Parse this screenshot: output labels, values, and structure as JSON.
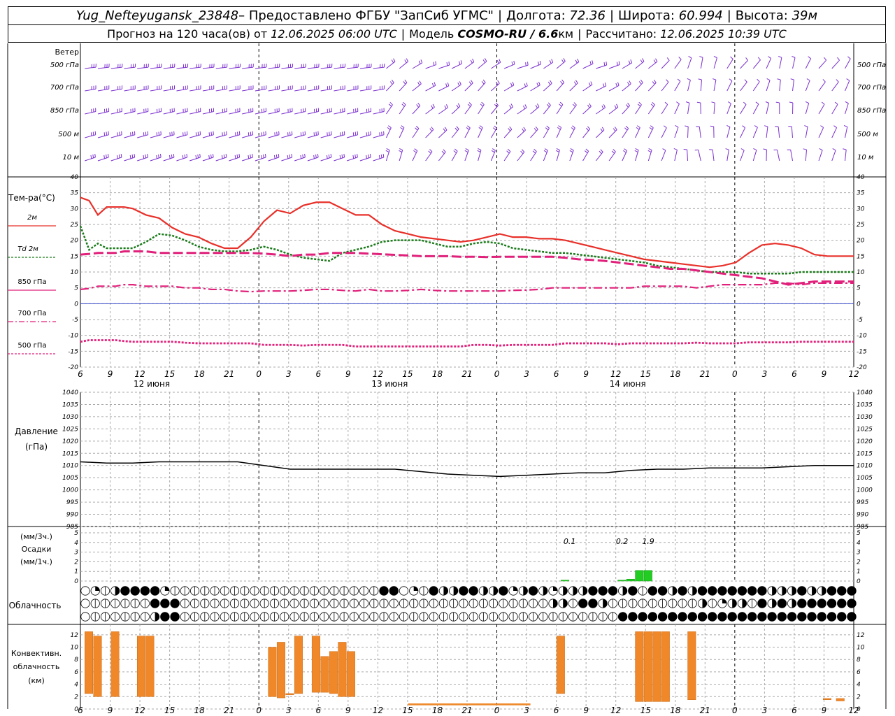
{
  "header": {
    "station": "Yug_Nefteyugansk_23848",
    "provider": " – Предоставлено ФГБУ \"ЗапСиб УГМС\"",
    "lon_label": "Долгота:",
    "lon": "72.36",
    "lat_label": "Широта:",
    "lat": "60.994",
    "alt_label": "Высота:",
    "alt": "39м",
    "forecast_label": "Прогноз на 120 часа(ов) от",
    "forecast_from": "12.06.2025 06:00 UTC",
    "model_label": "Модель",
    "model": "COSMO-RU / 6.6",
    "model_unit": "км",
    "calc_label": "Рассчитано:",
    "calc_time": "12.06.2025 10:39 UTC"
  },
  "time_axis": {
    "hour_labels": [
      "6",
      "9",
      "12",
      "15",
      "18",
      "21",
      "0",
      "3",
      "6",
      "9",
      "12",
      "15",
      "18",
      "21",
      "0",
      "3",
      "6",
      "9",
      "12",
      "15",
      "18",
      "21",
      "0",
      "3",
      "6",
      "9",
      "12"
    ],
    "day_labels": [
      "12 июня",
      "13 июня",
      "14 июня"
    ]
  },
  "wind": {
    "title": "Ветер",
    "levels": [
      "500 гПа",
      "700 гПа",
      "850 гПа",
      "500 м",
      "10 м"
    ],
    "color": "#7b2fd0"
  },
  "chart_data": [
    {
      "type": "line",
      "panel": "temperature",
      "ylabel": "Тем-ра(°C)",
      "ylim": [
        -20,
        40
      ],
      "yticks": [
        40,
        35,
        30,
        25,
        20,
        15,
        10,
        5,
        0,
        -5,
        -10,
        -15,
        -20
      ],
      "x_unit": "hours since 12.06.2025 06:00 UTC",
      "x": [
        0,
        2,
        4,
        6,
        8,
        10,
        12,
        15,
        18,
        21,
        24,
        27,
        30,
        33,
        36,
        39,
        42,
        45,
        48,
        51,
        54,
        57,
        60,
        63,
        66,
        69,
        72,
        75,
        78,
        81,
        84,
        87,
        90,
        93,
        96,
        99,
        102,
        105,
        108,
        111,
        114,
        117,
        120,
        123,
        126,
        129,
        132,
        135,
        138,
        141,
        144,
        147,
        150,
        153,
        156,
        159,
        162,
        165,
        168,
        171,
        174,
        177
      ],
      "legend": [
        "2м",
        "Td 2м",
        "850 гПа",
        "700 гПа",
        "500 гПа"
      ],
      "series": [
        {
          "name": "2м",
          "color": "#e8302a",
          "values": [
            33.5,
            32.5,
            28,
            30.5,
            30.5,
            30.5,
            30,
            28,
            27,
            24,
            22,
            21,
            19,
            17.5,
            17.5,
            21,
            26,
            29.5,
            28.5,
            31,
            32,
            32,
            30,
            28,
            28,
            25,
            23,
            22,
            21,
            20.5,
            20,
            19.5,
            20,
            21,
            22,
            21,
            21,
            20.5,
            20.5,
            20,
            19,
            18,
            17,
            16,
            15,
            14,
            13.5,
            13,
            12.5,
            12,
            11.5,
            12,
            13,
            16,
            18.5,
            19,
            18.5,
            17.5,
            15.5,
            15,
            15,
            15
          ]
        },
        {
          "name": "Td 2м",
          "color": "#1a7a1a",
          "values": [
            24.5,
            17,
            19,
            17.5,
            17.5,
            17.5,
            17.5,
            19.5,
            22,
            21.5,
            20,
            18,
            17,
            16.5,
            16.5,
            17,
            18,
            17,
            15.5,
            14.5,
            14,
            13.5,
            16,
            17,
            18,
            19.5,
            20,
            20,
            20,
            19,
            18,
            18,
            19,
            19.5,
            19,
            17.5,
            17,
            16.5,
            16,
            16,
            15.5,
            15,
            14.5,
            14,
            13.5,
            13,
            12,
            11.5,
            11,
            10.5,
            10,
            10,
            10,
            9.5,
            9.5,
            9.5,
            9.5,
            10,
            10,
            10,
            10,
            10
          ]
        },
        {
          "name": "850 гПа",
          "color": "#e0207a",
          "values": [
            15.5,
            15.7,
            16,
            16,
            16,
            16.5,
            16.5,
            16.5,
            16,
            16,
            16,
            16,
            16,
            16,
            16,
            16,
            15.8,
            15.5,
            15,
            15.5,
            15.5,
            16,
            16,
            16,
            15.8,
            15.6,
            15.4,
            15.2,
            15,
            15,
            15,
            14.8,
            14.8,
            14.7,
            14.8,
            14.8,
            14.8,
            14.8,
            14.8,
            14.5,
            14,
            13.8,
            13.5,
            13,
            12.5,
            12,
            11.5,
            11,
            11,
            10.5,
            10,
            9.5,
            9,
            8.5,
            8,
            7,
            6,
            6.5,
            7,
            7,
            7,
            7
          ]
        },
        {
          "name": "700 гПа",
          "color": "#e0207a",
          "values": [
            4.5,
            4.8,
            5.5,
            5.5,
            5.5,
            6,
            6,
            5.5,
            5.5,
            5.5,
            5,
            5,
            4.5,
            4.5,
            4,
            3.8,
            4,
            4,
            4,
            4.2,
            4.5,
            4.5,
            4.2,
            4,
            4.5,
            4,
            4,
            4.2,
            4.5,
            4.2,
            4,
            4,
            4,
            4,
            4,
            4.2,
            4.3,
            4.5,
            5,
            5,
            5,
            5,
            5,
            5,
            5,
            5.5,
            5.5,
            5.5,
            5.5,
            5,
            5.5,
            6,
            6,
            6,
            6,
            6.5,
            6.5,
            6,
            6.5,
            6.5,
            6.5,
            6.5
          ]
        },
        {
          "name": "500 гПа",
          "color": "#e0207a",
          "values": [
            -12,
            -11.5,
            -11.5,
            -11.5,
            -11.5,
            -11.8,
            -12,
            -12,
            -12,
            -12,
            -12.3,
            -12.5,
            -12.5,
            -12.5,
            -12.5,
            -12.5,
            -13,
            -13,
            -13,
            -13.2,
            -13,
            -13,
            -13,
            -13.5,
            -13.5,
            -13.5,
            -13.5,
            -13.5,
            -13.5,
            -13.5,
            -13.5,
            -13.5,
            -13,
            -13,
            -13.2,
            -13,
            -13,
            -13,
            -13,
            -12.5,
            -12.5,
            -12.5,
            -12.5,
            -12.8,
            -12.5,
            -12.5,
            -12.5,
            -12.5,
            -12.5,
            -12.3,
            -12.5,
            -12.5,
            -12.5,
            -12.2,
            -12.2,
            -12.2,
            -12.2,
            -12,
            -12,
            -12,
            -12,
            -12
          ]
        }
      ]
    },
    {
      "type": "line",
      "panel": "pressure",
      "ylabel": "Давление",
      "ylabel2": "(гПа)",
      "ylim": [
        985,
        1040
      ],
      "yticks": [
        1040,
        1035,
        1030,
        1025,
        1020,
        1015,
        1010,
        1005,
        1000,
        995,
        990,
        985
      ],
      "x": [
        0,
        6,
        12,
        18,
        24,
        30,
        36,
        42,
        48,
        54,
        60,
        66,
        72,
        78,
        84,
        90,
        96,
        102,
        108,
        114,
        120,
        126,
        132,
        138,
        144,
        150,
        156,
        162,
        168,
        174,
        177
      ],
      "series": [
        {
          "name": "",
          "color": "#000000",
          "values": [
            1011.5,
            1011,
            1011,
            1011.5,
            1011.5,
            1011.5,
            1011.5,
            1010,
            1008.5,
            1008.5,
            1008.5,
            1008.5,
            1008.5,
            1007.5,
            1006.5,
            1006,
            1005.5,
            1006,
            1006.5,
            1007,
            1007,
            1008,
            1008.5,
            1008.5,
            1009,
            1009,
            1009,
            1009.5,
            1010,
            1010,
            1010
          ]
        }
      ]
    },
    {
      "type": "bar",
      "panel": "precipitation",
      "ylabel": "(мм/3ч.)",
      "ylabel2": "Осадки",
      "ylabel3": "(мм/1ч.)",
      "ylim": [
        0,
        5
      ],
      "yticks": [
        5,
        4,
        3,
        2,
        1,
        0
      ],
      "x": [
        111,
        124,
        126,
        128,
        130,
        132
      ],
      "values": [
        0.1,
        0.1,
        0.2,
        1.1,
        1.1,
        0.0
      ],
      "color": "#22cc22",
      "annotations": [
        "0.1",
        "0.2",
        "1.9"
      ]
    },
    {
      "type": "bar",
      "panel": "convective_clouds",
      "ylabel": "Конвективн.",
      "ylabel2": "облачность",
      "ylabel3": "(км)",
      "ylim": [
        0,
        13
      ],
      "yticks": [
        12,
        10,
        8,
        6,
        4,
        2,
        0
      ],
      "color": "#f0882a",
      "bars": [
        {
          "x": 2,
          "bottom": 2.5,
          "top": 12.5
        },
        {
          "x": 4,
          "bottom": 2,
          "top": 11.8
        },
        {
          "x": 8,
          "bottom": 2,
          "top": 12.5
        },
        {
          "x": 14,
          "bottom": 2,
          "top": 11.8
        },
        {
          "x": 16,
          "bottom": 2,
          "top": 11.8
        },
        {
          "x": 44,
          "bottom": 2,
          "top": 10
        },
        {
          "x": 46,
          "bottom": 1.8,
          "top": 10.8
        },
        {
          "x": 48,
          "bottom": 2.3,
          "top": 2.5
        },
        {
          "x": 50,
          "bottom": 2.5,
          "top": 11.8
        },
        {
          "x": 54,
          "bottom": 2.7,
          "top": 11.8
        },
        {
          "x": 56,
          "bottom": 2.7,
          "top": 8.5
        },
        {
          "x": 58,
          "bottom": 2.5,
          "top": 9.3
        },
        {
          "x": 60,
          "bottom": 2,
          "top": 10.8
        },
        {
          "x": 62,
          "bottom": 2,
          "top": 9.3
        },
        {
          "x": 110,
          "bottom": 2.5,
          "top": 11.8
        },
        {
          "x": 128,
          "bottom": 1.2,
          "top": 12.5
        },
        {
          "x": 130,
          "bottom": 1.2,
          "top": 12.5
        },
        {
          "x": 132,
          "bottom": 1.2,
          "top": 12.5
        },
        {
          "x": 134,
          "bottom": 1.2,
          "top": 12.5
        },
        {
          "x": 140,
          "bottom": 1.5,
          "top": 12.5
        },
        {
          "x": 171,
          "bottom": 1.5,
          "top": 1.7
        },
        {
          "x": 174,
          "bottom": 1.3,
          "top": 1.7
        }
      ],
      "thin_layer": {
        "from": 75,
        "to": 103,
        "bottom": 0.6,
        "top": 0.9
      }
    }
  ],
  "cloud": {
    "label": "Облачность",
    "rows": [
      "0123444412222222222222222222224401243344334134313334443424434344444443334334444443442122222222222222222222222222222",
      "0222222444222222222222222222222222222222222222233244322222222232133243434444444444443344342243232222222222222222222",
      "0222222344222222222222222222222222222222222222222222224444444444444444444444444444444444444444344444444443332444444"
    ]
  }
}
